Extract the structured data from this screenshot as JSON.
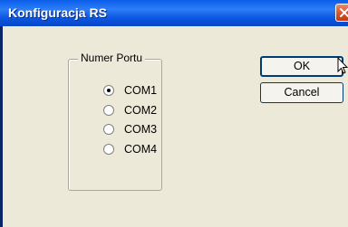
{
  "window": {
    "title": "Konfiguracja RS"
  },
  "port_group": {
    "label": "Numer Portu",
    "options": [
      {
        "label": "COM1",
        "selected": true
      },
      {
        "label": "COM2",
        "selected": false
      },
      {
        "label": "COM3",
        "selected": false
      },
      {
        "label": "COM4",
        "selected": false
      }
    ]
  },
  "buttons": {
    "ok_label": "OK",
    "cancel_label": "Cancel"
  },
  "colors": {
    "titlebar": "#0b55e0",
    "dialog_bg": "#ece9d8",
    "close_button": "#d8532a"
  }
}
